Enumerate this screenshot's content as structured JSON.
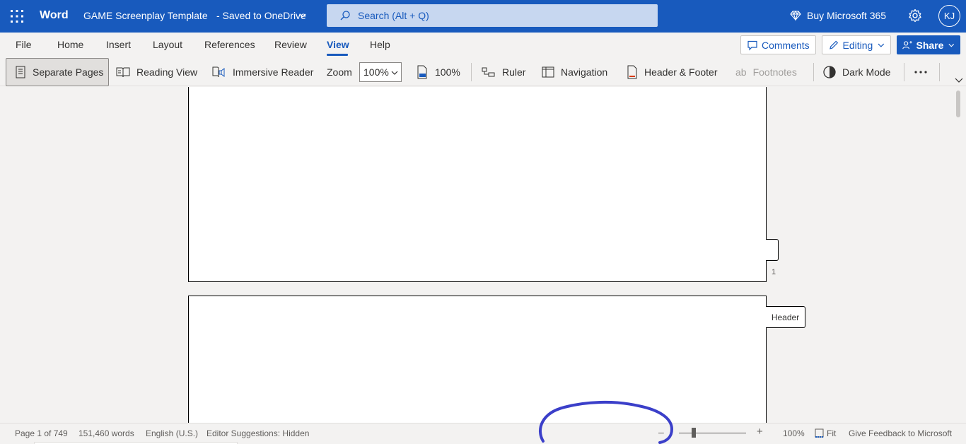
{
  "titlebar": {
    "app_name": "Word",
    "doc_title": "GAME Screenplay Template",
    "doc_status": "-  Saved to OneDrive",
    "search_placeholder": "Search (Alt + Q)",
    "buy_label": "Buy Microsoft 365",
    "avatar_initials": "KJ",
    "brand_color": "#185abd"
  },
  "menu": {
    "tabs": [
      {
        "label": "File"
      },
      {
        "label": "Home"
      },
      {
        "label": "Insert"
      },
      {
        "label": "Layout"
      },
      {
        "label": "References"
      },
      {
        "label": "Review"
      },
      {
        "label": "View",
        "active": true
      },
      {
        "label": "Help"
      }
    ],
    "comments_label": "Comments",
    "editing_label": "Editing",
    "share_label": "Share"
  },
  "ribbon": {
    "separate_pages": "Separate Pages",
    "reading_view": "Reading View",
    "immersive_reader": "Immersive Reader",
    "zoom_label": "Zoom",
    "zoom_value": "100%",
    "zoom_100": "100%",
    "ruler": "Ruler",
    "navigation": "Navigation",
    "header_footer": "Header & Footer",
    "footnotes": "Footnotes",
    "dark_mode": "Dark Mode",
    "more_icon": "more-icon"
  },
  "document": {
    "page_number": "1",
    "header_label": "Header"
  },
  "statusbar": {
    "page_info": "Page 1 of 749",
    "word_count": "151,460 words",
    "language": "English (U.S.)",
    "editor_suggestions": "Editor Suggestions: Hidden",
    "zoom_out": "–",
    "zoom_in": "+",
    "zoom_percent": "100%",
    "fit_label": "Fit",
    "feedback": "Give Feedback to Microsoft"
  },
  "annotation_color": "#3b3fc9"
}
